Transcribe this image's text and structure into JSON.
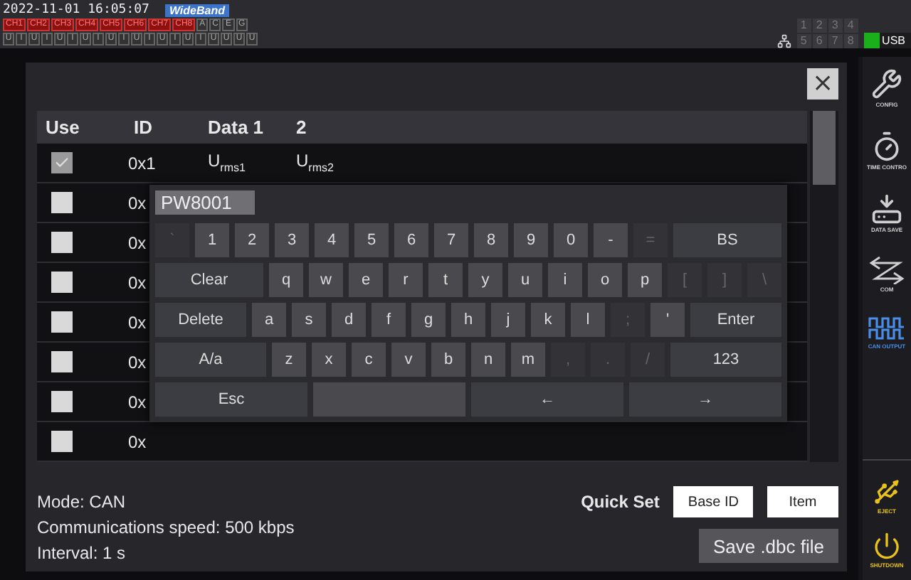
{
  "status_bar": {
    "datetime": "2022-11-01 16:05:07",
    "mode_badge": "WideBand",
    "channels": [
      {
        "label": "CH1",
        "on": true
      },
      {
        "label": "CH2",
        "on": true
      },
      {
        "label": "CH3",
        "on": true
      },
      {
        "label": "CH4",
        "on": true
      },
      {
        "label": "CH5",
        "on": true
      },
      {
        "label": "CH6",
        "on": true
      },
      {
        "label": "CH7",
        "on": true
      },
      {
        "label": "CH8",
        "on": true
      },
      {
        "label": "A",
        "on": false
      },
      {
        "label": "C",
        "on": false
      },
      {
        "label": "E",
        "on": false
      },
      {
        "label": "G",
        "on": false
      }
    ],
    "units": [
      "U",
      "I",
      "U",
      "I",
      "U",
      "I",
      "U",
      "I",
      "U",
      "I",
      "U",
      "I",
      "U",
      "I",
      "U",
      "I",
      "U",
      "U",
      "U",
      "U"
    ],
    "ports": [
      "1",
      "2",
      "3",
      "4",
      "5",
      "6",
      "7",
      "8"
    ],
    "usb": {
      "label": "USB",
      "on": true
    }
  },
  "sidebar": {
    "items": [
      {
        "label": "CONFIG",
        "kind": "config",
        "selected": false
      },
      {
        "label": "TIME CONTRO",
        "kind": "timer",
        "selected": false
      },
      {
        "label": "DATA SAVE",
        "kind": "save",
        "selected": false
      },
      {
        "label": "COM",
        "kind": "com",
        "selected": false
      },
      {
        "label": "CAN OUTPUT",
        "kind": "wave",
        "selected": true
      }
    ],
    "bottom_items": [
      {
        "label": "EJECT",
        "kind": "eject"
      },
      {
        "label": "SHUTDOWN",
        "kind": "power"
      }
    ]
  },
  "dialog": {
    "close": "×",
    "table": {
      "columns": [
        "Use",
        "ID",
        "Data 1",
        "2"
      ],
      "rows": [
        {
          "checked": true,
          "disabled": true,
          "id": "0x1",
          "data": [
            "U$_{rms1}$",
            "U$_{rms2}$"
          ]
        },
        {
          "checked": false,
          "disabled": false,
          "id": "0x",
          "data": []
        },
        {
          "checked": false,
          "disabled": false,
          "id": "0x",
          "data": []
        },
        {
          "checked": false,
          "disabled": false,
          "id": "0x",
          "data": []
        },
        {
          "checked": false,
          "disabled": false,
          "id": "0x",
          "data": []
        },
        {
          "checked": false,
          "disabled": false,
          "id": "0x",
          "data": []
        },
        {
          "checked": false,
          "disabled": false,
          "id": "0x",
          "data": []
        },
        {
          "checked": false,
          "disabled": false,
          "id": "0x",
          "data": []
        }
      ]
    },
    "keyboard": {
      "value": "PW8001",
      "rows": [
        {
          "keys": [
            {
              "label": "`",
              "kind": "off"
            },
            {
              "label": "1",
              "kind": "key"
            },
            {
              "label": "2",
              "kind": "key"
            },
            {
              "label": "3",
              "kind": "key"
            },
            {
              "label": "4",
              "kind": "key"
            },
            {
              "label": "5",
              "kind": "key"
            },
            {
              "label": "6",
              "kind": "key"
            },
            {
              "label": "7",
              "kind": "key"
            },
            {
              "label": "8",
              "kind": "key"
            },
            {
              "label": "9",
              "kind": "key"
            },
            {
              "label": "0",
              "kind": "key"
            },
            {
              "label": "-",
              "kind": "key"
            },
            {
              "label": "=",
              "kind": "off"
            },
            {
              "label": "BS",
              "kind": "func"
            }
          ]
        },
        {
          "keys": [
            {
              "label": "Clear",
              "kind": "func"
            },
            {
              "label": "q",
              "kind": "key"
            },
            {
              "label": "w",
              "kind": "key"
            },
            {
              "label": "e",
              "kind": "key"
            },
            {
              "label": "r",
              "kind": "key"
            },
            {
              "label": "t",
              "kind": "key"
            },
            {
              "label": "y",
              "kind": "key"
            },
            {
              "label": "u",
              "kind": "key"
            },
            {
              "label": "i",
              "kind": "key"
            },
            {
              "label": "o",
              "kind": "key"
            },
            {
              "label": "p",
              "kind": "key"
            },
            {
              "label": "[",
              "kind": "off"
            },
            {
              "label": "]",
              "kind": "off"
            },
            {
              "label": "\\",
              "kind": "off"
            }
          ]
        },
        {
          "keys": [
            {
              "label": "Delete",
              "kind": "func"
            },
            {
              "label": "a",
              "kind": "key"
            },
            {
              "label": "s",
              "kind": "key"
            },
            {
              "label": "d",
              "kind": "key"
            },
            {
              "label": "f",
              "kind": "key"
            },
            {
              "label": "g",
              "kind": "key"
            },
            {
              "label": "h",
              "kind": "key"
            },
            {
              "label": "j",
              "kind": "key"
            },
            {
              "label": "k",
              "kind": "key"
            },
            {
              "label": "l",
              "kind": "key"
            },
            {
              "label": ";",
              "kind": "off"
            },
            {
              "label": "'",
              "kind": "key"
            },
            {
              "label": "Enter",
              "kind": "func"
            }
          ]
        },
        {
          "keys": [
            {
              "label": "A/a",
              "kind": "func"
            },
            {
              "label": "z",
              "kind": "key"
            },
            {
              "label": "x",
              "kind": "key"
            },
            {
              "label": "c",
              "kind": "key"
            },
            {
              "label": "v",
              "kind": "key"
            },
            {
              "label": "b",
              "kind": "key"
            },
            {
              "label": "n",
              "kind": "key"
            },
            {
              "label": "m",
              "kind": "key"
            },
            {
              "label": ",",
              "kind": "off"
            },
            {
              "label": ".",
              "kind": "off"
            },
            {
              "label": "/",
              "kind": "off"
            },
            {
              "label": "123",
              "kind": "func"
            }
          ]
        },
        {
          "keys": [
            {
              "label": "Esc",
              "kind": "func"
            },
            {
              "kind": "space"
            },
            {
              "label": "←",
              "kind": "func"
            },
            {
              "label": "→",
              "kind": "func"
            }
          ]
        }
      ]
    },
    "info": [
      "Mode: CAN",
      "Communications speed: 500 kbps",
      "Interval: 1 s"
    ],
    "quick_set": {
      "label": "Quick Set",
      "buttons": [
        "Base ID",
        "Item"
      ]
    },
    "save_button": "Save .dbc file"
  }
}
